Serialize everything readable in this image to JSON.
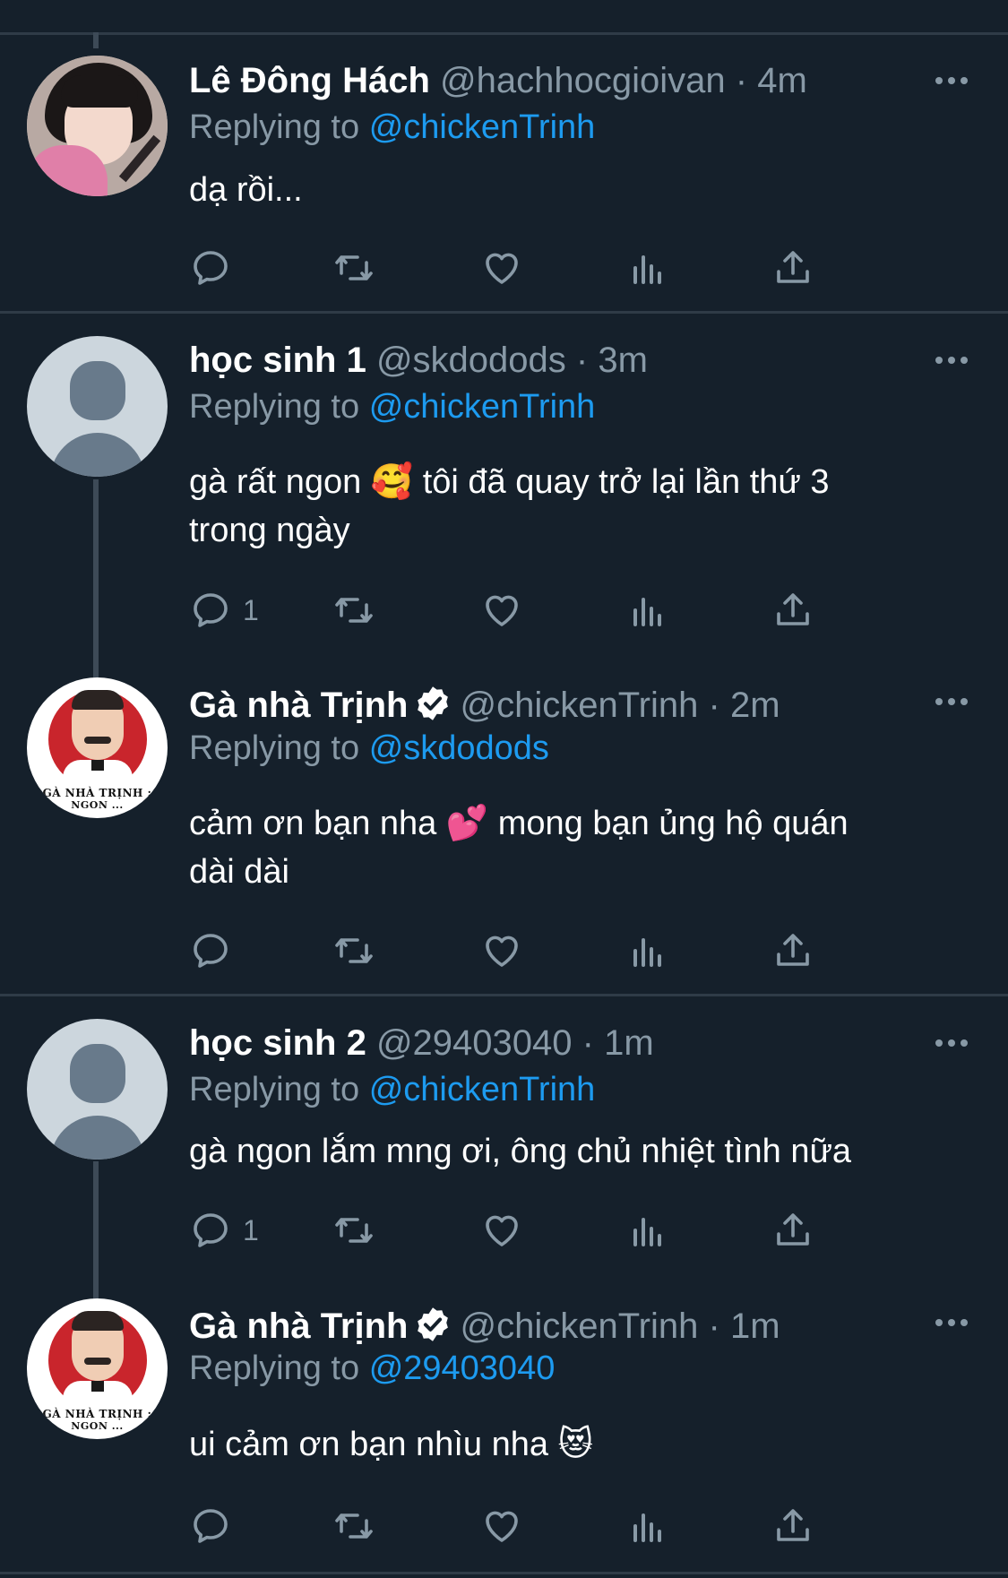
{
  "tweets": [
    {
      "name": "Lê Đông Hách",
      "handle": "@hachhocgioivan",
      "dot": "·",
      "time": "4m",
      "verified": false,
      "replying_prefix": "Replying to",
      "replying_to": "@chickenTrinh",
      "body_lines": [
        "dạ rồi..."
      ],
      "reply_count": "",
      "avatar": "photo-avatar"
    },
    {
      "name": "học sinh 1",
      "handle": "@skdodods",
      "dot": "·",
      "time": "3m",
      "verified": false,
      "replying_prefix": "Replying to",
      "replying_to": "@chickenTrinh",
      "body_lines": [
        "gà rất ngon 🥰  tôi đã quay trở lại lần thứ 3",
        "trong ngày"
      ],
      "reply_count": "1",
      "avatar": "default-avatar"
    },
    {
      "name": "Gà nhà Trịnh",
      "handle": "@chickenTrinh",
      "dot": "·",
      "time": "2m",
      "verified": true,
      "replying_prefix": "Replying to",
      "replying_to": "@skdodods",
      "body_lines": [
        "cảm ơn bạn nha 💕  mong bạn ủng hộ quán",
        "dài dài"
      ],
      "reply_count": "",
      "avatar": "logo-avatar"
    },
    {
      "name": "học sinh 2",
      "handle": "@29403040",
      "dot": "·",
      "time": "1m",
      "verified": false,
      "replying_prefix": "Replying to",
      "replying_to": "@chickenTrinh",
      "body_lines": [
        "gà ngon lắm mng ơi, ông chủ nhiệt tình nữa"
      ],
      "reply_count": "1",
      "avatar": "default-avatar"
    },
    {
      "name": "Gà nhà Trịnh",
      "handle": "@chickenTrinh",
      "dot": "·",
      "time": "1m",
      "verified": true,
      "replying_prefix": "Replying to",
      "replying_to": "@29403040",
      "body_lines": [
        "ui cảm ơn bạn nhìu nha 😻"
      ],
      "reply_count": "",
      "avatar": "logo-avatar"
    }
  ],
  "logo_text": [
    "GÀ NHÀ TRỊNH :",
    "NGON ..."
  ],
  "colors": {
    "background": "#15202b",
    "divider": "#2f3b47",
    "secondary_text": "#8899a6",
    "mention": "#1d9bf0"
  },
  "icons": {
    "reply": "reply-icon",
    "retweet": "retweet-icon",
    "like": "heart-icon",
    "views": "views-icon",
    "share": "share-icon",
    "more": "more-icon",
    "verified": "verified-badge-icon"
  }
}
